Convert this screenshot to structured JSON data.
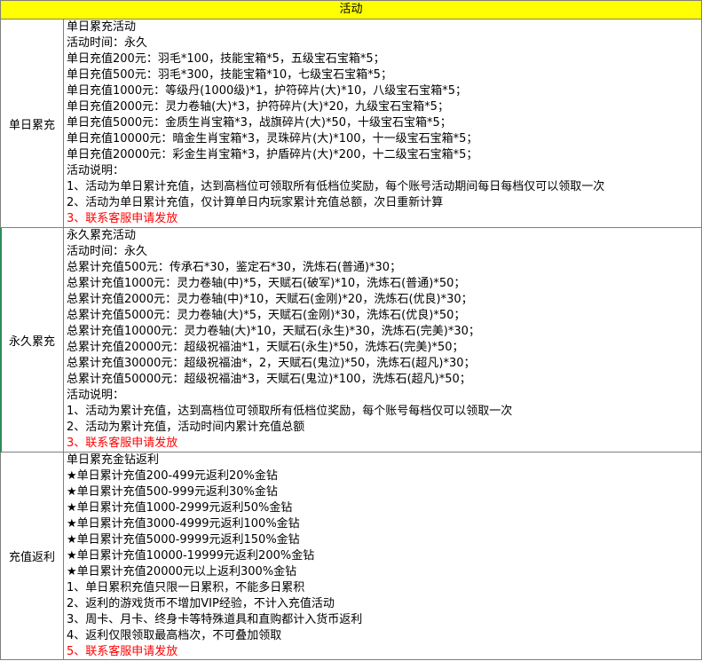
{
  "header": "活动",
  "sections": [
    {
      "label": "单日累充",
      "lines": [
        {
          "text": "单日累充活动"
        },
        {
          "text": "活动时间：永久"
        },
        {
          "text": "单日充值200元：羽毛*100，技能宝箱*5，五级宝石宝箱*5；"
        },
        {
          "text": "单日充值500元：羽毛*300，技能宝箱*10，七级宝石宝箱*5；"
        },
        {
          "text": "单日充值1000元：等级丹(1000级)*1，护符碎片(大)*10，八级宝石宝箱*5；"
        },
        {
          "text": "单日充值2000元：灵力卷轴(大)*3，护符碎片(大)*20，九级宝石宝箱*5；"
        },
        {
          "text": "单日充值5000元：金质生肖宝箱*3，战旗碎片(大)*50，十级宝石宝箱*5；"
        },
        {
          "text": "单日充值10000元：暗金生肖宝箱*3，灵珠碎片(大)*100，十一级宝石宝箱*5；"
        },
        {
          "text": "单日充值20000元：彩金生肖宝箱*3，护盾碎片(大)*200，十二级宝石宝箱*5；"
        },
        {
          "text": "活动说明："
        },
        {
          "text": "1、活动为单日累计充值，达到高档位可领取所有低档位奖励，每个账号活动期间每日每档仅可以领取一次"
        },
        {
          "text": "2、活动为单日累计充值，仅计算单日内玩家累计充值总额，次日重新计算"
        },
        {
          "text": "3、联系客服申请发放",
          "red": true
        }
      ]
    },
    {
      "label": "永久累充",
      "lines": [
        {
          "text": "永久累充活动"
        },
        {
          "text": "活动时间：永久"
        },
        {
          "text": "总累计充值500元：传承石*30，鉴定石*30，洗炼石(普通)*30；"
        },
        {
          "text": "总累计充值1000元：灵力卷轴(中)*5，天赋石(破军)*10，洗炼石(普通)*50；"
        },
        {
          "text": "总累计充值2000元：灵力卷轴(中)*10，天赋石(金刚)*20，洗炼石(优良)*30；"
        },
        {
          "text": "总累计充值5000元：灵力卷轴(大)*5，天赋石(金刚)*30，洗炼石(优良)*50；"
        },
        {
          "text": "总累计充值10000元：灵力卷轴(大)*10，天赋石(永生)*30，洗炼石(完美)*30；"
        },
        {
          "text": "总累计充值20000元：超级祝福油*1，天赋石(永生)*50，洗炼石(完美)*50；"
        },
        {
          "text": "总累计充值30000元：超级祝福油*，2，天赋石(鬼泣)*50，洗炼石(超凡)*30；"
        },
        {
          "text": "总累计充值50000元：超级祝福油*3，天赋石(鬼泣)*100，洗炼石(超凡)*50；"
        },
        {
          "text": "活动说明："
        },
        {
          "text": "1、活动为累计充值，达到高档位可领取所有低档位奖励，每个账号每档仅可以领取一次"
        },
        {
          "text": "2、活动为累计充值，活动时间内累计充值总额"
        },
        {
          "text": "3、联系客服申请发放",
          "red": true
        }
      ]
    },
    {
      "label": "充值返利",
      "lines": [
        {
          "text": "单日累充金钻返利"
        },
        {
          "text": "★单日累计充值200-499元返利20%金钻"
        },
        {
          "text": "★单日累计充值500-999元返利30%金钻"
        },
        {
          "text": "★单日累计充值1000-2999元返利50%金钻"
        },
        {
          "text": "★单日累计充值3000-4999元返利100%金钻"
        },
        {
          "text": "★单日累计充值5000-9999元返利150%金钻"
        },
        {
          "text": "★单日累计充值10000-19999元返利200%金钻"
        },
        {
          "text": "★单日累计充值20000元以上返利300%金钻"
        },
        {
          "text": "1、单日累积充值只限一日累积，不能多日累积"
        },
        {
          "text": "2、返利的游戏货币不增加VIP经验，不计入充值活动"
        },
        {
          "text": "3、周卡、月卡、终身卡等特殊道具和直购都计入货币返利"
        },
        {
          "text": "4、返利仅限领取最高档次，不可叠加领取"
        },
        {
          "text": "5、联系客服申请发放",
          "red": true
        }
      ]
    }
  ]
}
